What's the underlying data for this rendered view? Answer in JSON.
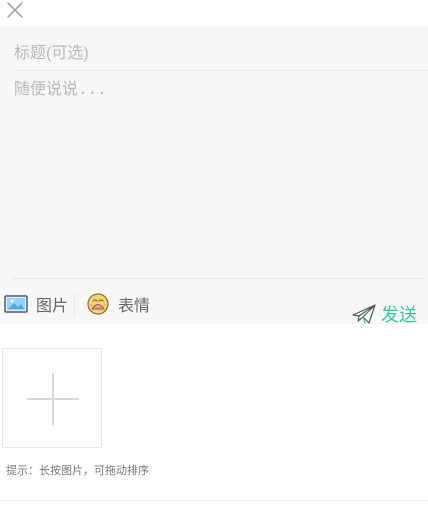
{
  "composer": {
    "title_placeholder": "标题(可选)",
    "body_placeholder": "随便说说..."
  },
  "toolbar": {
    "image_label": "图片",
    "emoji_label": "表情",
    "send_label": "发送"
  },
  "uploader": {
    "hint": "提示：长按图片，可拖动排序"
  },
  "icons": {
    "close": "close-icon",
    "image": "image-icon",
    "emoji": "emoji-icon",
    "send": "paper-plane-icon",
    "add": "plus-icon"
  },
  "colors": {
    "accent": "#38c59a",
    "panel": "#f7f7f7",
    "placeholder": "#b8b8b8"
  }
}
